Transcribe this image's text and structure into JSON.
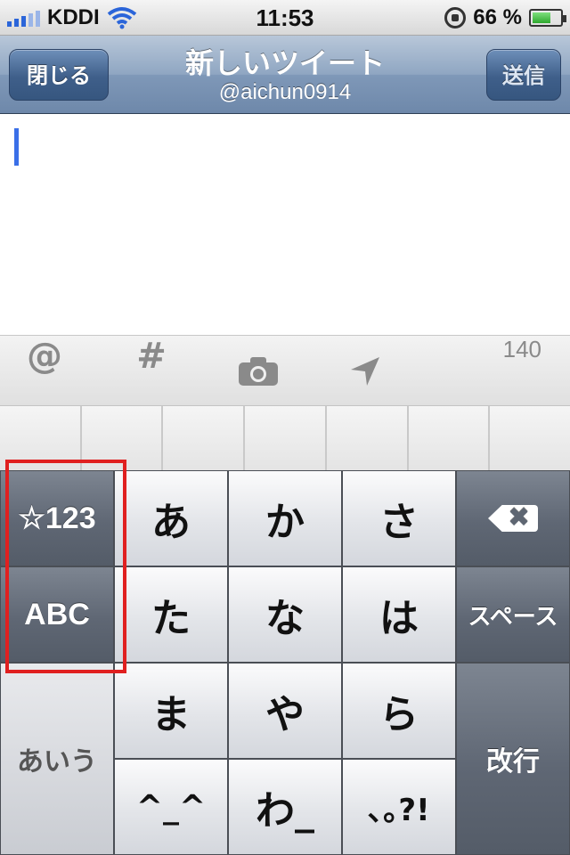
{
  "status_bar": {
    "carrier": "KDDI",
    "time": "11:53",
    "battery": "66 %",
    "battery_level": 0.66,
    "icons": [
      "signal-icon",
      "wifi-icon",
      "rotation-lock-icon",
      "battery-icon"
    ]
  },
  "nav": {
    "close_label": "閉じる",
    "title": "新しいツイート",
    "account": "@aichun0914",
    "send_label": "送信"
  },
  "toolbar": {
    "mention": "@",
    "hashtag": "#",
    "camera_icon": "camera-icon",
    "location_icon": "location-arrow-icon",
    "char_count": "140"
  },
  "keyboard": {
    "mode_numbers": "☆123",
    "mode_abc": "ABC",
    "mode_kana": "あいう",
    "row1": [
      "あ",
      "か",
      "さ"
    ],
    "row2": [
      "た",
      "な",
      "は"
    ],
    "row3": [
      "ま",
      "や",
      "ら"
    ],
    "row4": [
      "^_^",
      "わ_",
      "､｡?!"
    ],
    "space": "スペース",
    "enter": "改行",
    "backspace_icon": "backspace-icon",
    "backspace_glyph": "✖"
  },
  "colors": {
    "nav_blue": "#6e88aa",
    "caret": "#3a6fe8",
    "highlight": "#e02020"
  }
}
